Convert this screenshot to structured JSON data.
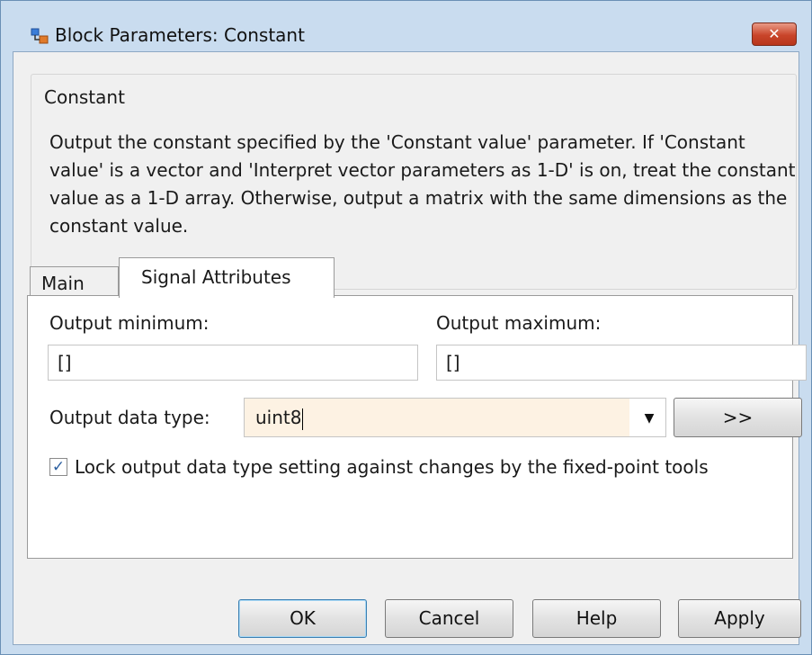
{
  "window": {
    "title": "Block Parameters: Constant",
    "close_glyph": "✕"
  },
  "group": {
    "legend": "Constant",
    "description": "Output the constant specified by the 'Constant value' parameter. If 'Constant value' is a vector and 'Interpret vector parameters as 1-D' is on, treat the constant value as a 1-D array. Otherwise, output a matrix with the same dimensions as the constant value."
  },
  "tabs": [
    {
      "label": "Main",
      "active": false
    },
    {
      "label": "Signal Attributes",
      "active": true
    }
  ],
  "signal": {
    "output_min_label": "Output minimum:",
    "output_min_value": "[]",
    "output_max_label": "Output maximum:",
    "output_max_value": "[]",
    "data_type_label": "Output data type:",
    "data_type_value": "uint8",
    "assistant_button": ">>",
    "lock_checked": true,
    "lock_label": "Lock output data type setting against changes by the fixed-point tools"
  },
  "buttons": {
    "ok": "OK",
    "cancel": "Cancel",
    "help": "Help",
    "apply": "Apply"
  },
  "icons": {
    "app": "simulink-block-icon",
    "close": "close-icon",
    "dropdown": "chevron-down-icon",
    "check": "checkmark-icon"
  },
  "colors": {
    "frame": "#c9dcef",
    "close_button": "#c9452a",
    "combo_highlight": "#fdf2e3"
  }
}
